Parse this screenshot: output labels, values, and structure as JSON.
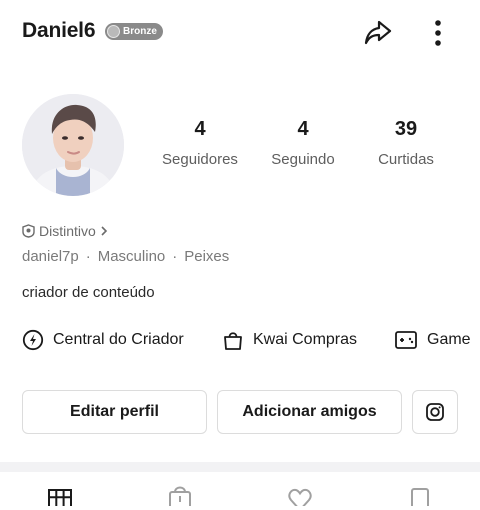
{
  "profile": {
    "username": "Daniel6",
    "badge_label": "Bronze",
    "badge_color": "#8a8a8a",
    "followers_count": "4",
    "followers_label": "Seguidores",
    "following_count": "4",
    "following_label": "Seguindo",
    "likes_count": "39",
    "likes_label": "Curtidas",
    "distintivo_label": "Distintivo",
    "handle": "daniel7p",
    "gender": "Masculino",
    "sign": "Peixes",
    "separator": "·",
    "bio": "criador de conteúdo"
  },
  "quick_links": [
    {
      "label": "Central do Criador",
      "icon": "lightning-circle-icon"
    },
    {
      "label": "Kwai Compras",
      "icon": "shopping-bag-icon"
    },
    {
      "label": "Game",
      "icon": "gamepad-icon"
    }
  ],
  "actions": {
    "edit_profile": "Editar perfil",
    "add_friends": "Adicionar amigos",
    "instagram_icon": "instagram-icon"
  },
  "tabs": [
    {
      "icon": "grid-icon"
    },
    {
      "icon": "lock-bag-icon"
    },
    {
      "icon": "heart-icon"
    },
    {
      "icon": "bookmark-icon"
    }
  ]
}
